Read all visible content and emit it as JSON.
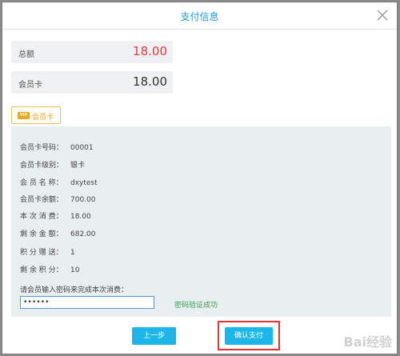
{
  "dialog": {
    "title": "支付信息"
  },
  "summary": {
    "total_label": "总额",
    "total_value": "18.00",
    "card_label": "会员卡",
    "card_value": "18.00"
  },
  "payment_tab": {
    "badge": "VIP",
    "label": "会员卡"
  },
  "member": {
    "rows": [
      {
        "key": "会员卡号码：",
        "value": "00001"
      },
      {
        "key": "会员卡级别：",
        "value": "银卡"
      },
      {
        "key": "会 员 名 称：",
        "value": "dxytest"
      },
      {
        "key": "会员卡余额：",
        "value": "700.00"
      },
      {
        "key": "本 次 消 费：",
        "value": "18.00"
      },
      {
        "key": "剩 余 金 额：",
        "value": "682.00"
      },
      {
        "key": "积 分 赠 送：",
        "value": "1"
      },
      {
        "key": "剩 余 积 分：",
        "value": "10"
      }
    ],
    "password_prompt": "请会员输入密码来完成本次消费：",
    "password_value": "••••••",
    "password_status": "密码验证成功"
  },
  "buttons": {
    "prev": "上一步",
    "confirm": "确认支付"
  },
  "watermark": "Bai经验",
  "colors": {
    "accent": "#1cb6e9",
    "total": "#e4393c",
    "success": "#27a94e",
    "highlight": "#e33432"
  }
}
